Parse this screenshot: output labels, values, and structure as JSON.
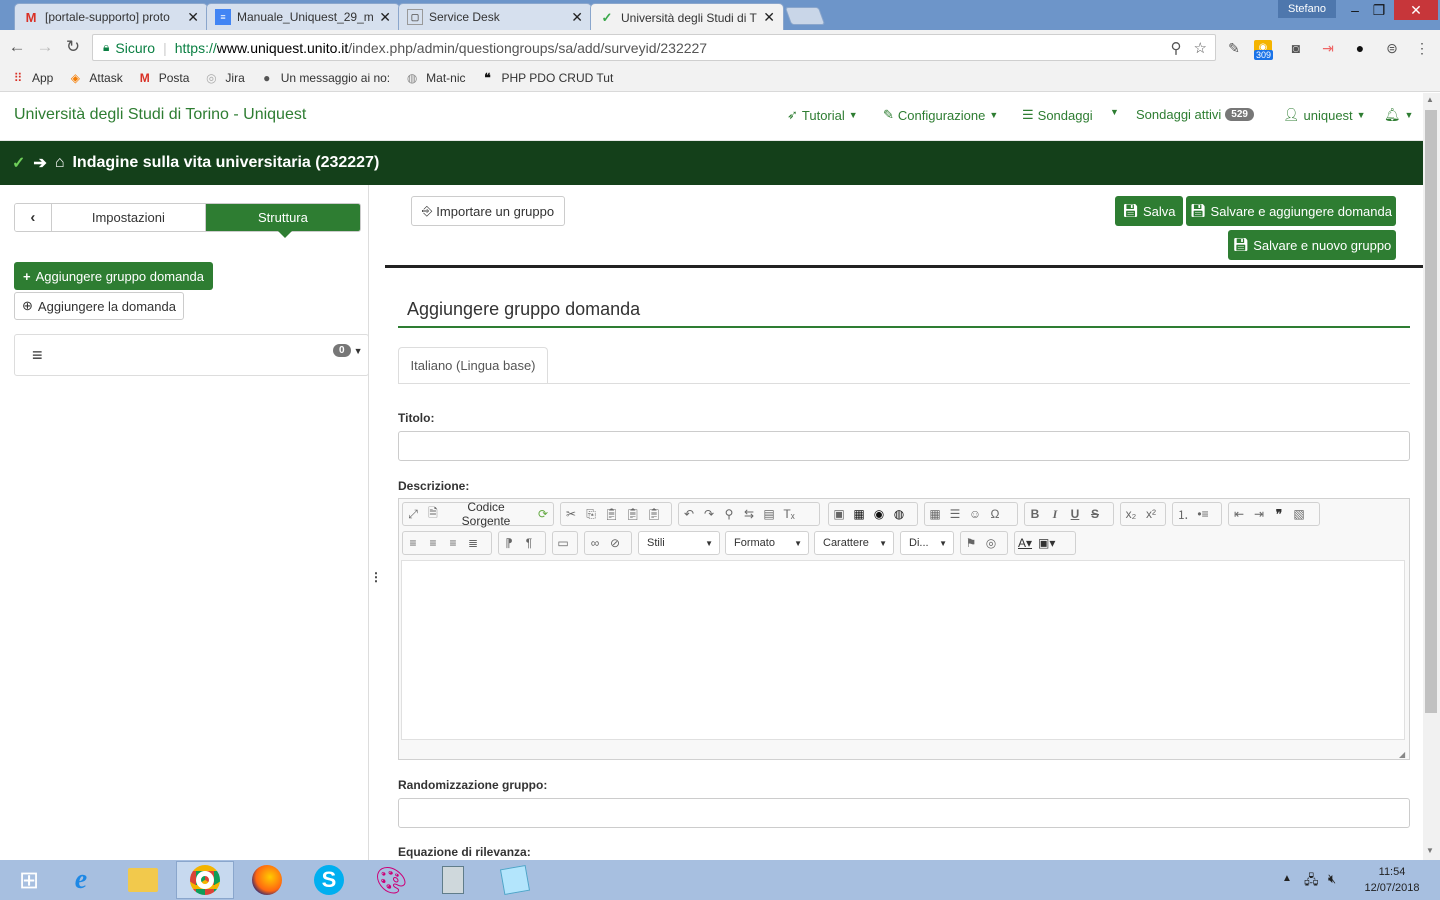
{
  "browser": {
    "tabs": [
      {
        "icon": "gmail-icon",
        "title": "[portale-supporto] proto",
        "active": false
      },
      {
        "icon": "docs-icon",
        "title": "Manuale_Uniquest_29_m",
        "active": false
      },
      {
        "icon": "servicedesk-icon",
        "title": "Service Desk",
        "active": false
      },
      {
        "icon": "uniquest-icon",
        "title": "Università degli Studi di T",
        "active": true
      }
    ],
    "window_user": "Stefano",
    "security_label": "Sicuro",
    "url_prefix": "https://",
    "url_domain": "www.uniquest.unito.it",
    "url_path": "/index.php/admin/questiongroups/sa/add/surveyid/232227",
    "extension_badge": "309",
    "bookmarks": [
      {
        "icon": "apps-icon",
        "label": "App"
      },
      {
        "icon": "attask-icon",
        "label": "Attask"
      },
      {
        "icon": "gmail-icon",
        "label": "Posta"
      },
      {
        "icon": "jira-icon",
        "label": "Jira"
      },
      {
        "icon": "apple-icon",
        "label": "Un messaggio ai no:"
      },
      {
        "icon": "matnic-icon",
        "label": "Mat-nic"
      },
      {
        "icon": "quote-icon",
        "label": "PHP PDO CRUD Tut"
      }
    ]
  },
  "header": {
    "brand": "Università degli Studi di Torino - Uniquest",
    "nav": {
      "tutorial": "Tutorial",
      "configurazione": "Configurazione",
      "sondaggi": "Sondaggi",
      "sondaggi_attivi": "Sondaggi attivi",
      "sondaggi_attivi_count": "529",
      "user": "uniquest"
    }
  },
  "survey": {
    "title": "Indagine sulla vita universitaria (232227)"
  },
  "sidebar": {
    "tab_settings": "Impostazioni",
    "tab_structure": "Struttura",
    "add_group": "Aggiungere gruppo domanda",
    "add_question": "Aggiungere la domanda",
    "explorer_count": "0"
  },
  "main": {
    "import_group": "Importare un gruppo",
    "save": "Salva",
    "save_add_question": "Salvare e aggiungere domanda",
    "save_new_group": "Salvare e nuovo gruppo",
    "form_title": "Aggiungere gruppo domanda",
    "lang_tab": "Italiano (Lingua base)",
    "label_title": "Titolo:",
    "label_description": "Descrizione:",
    "label_randomization": "Randomizzazione gruppo:",
    "label_relevance": "Equazione di rilevanza:",
    "editor": {
      "source_label": "Codice Sorgente",
      "styles": "Stili",
      "format": "Formato",
      "font": "Carattere",
      "size": "Di..."
    }
  },
  "taskbar": {
    "time": "11:54",
    "date": "12/07/2018"
  },
  "colors": {
    "accent": "#2e7d32",
    "surveybar": "#14401a",
    "taskbar": "#a7bfe0"
  }
}
